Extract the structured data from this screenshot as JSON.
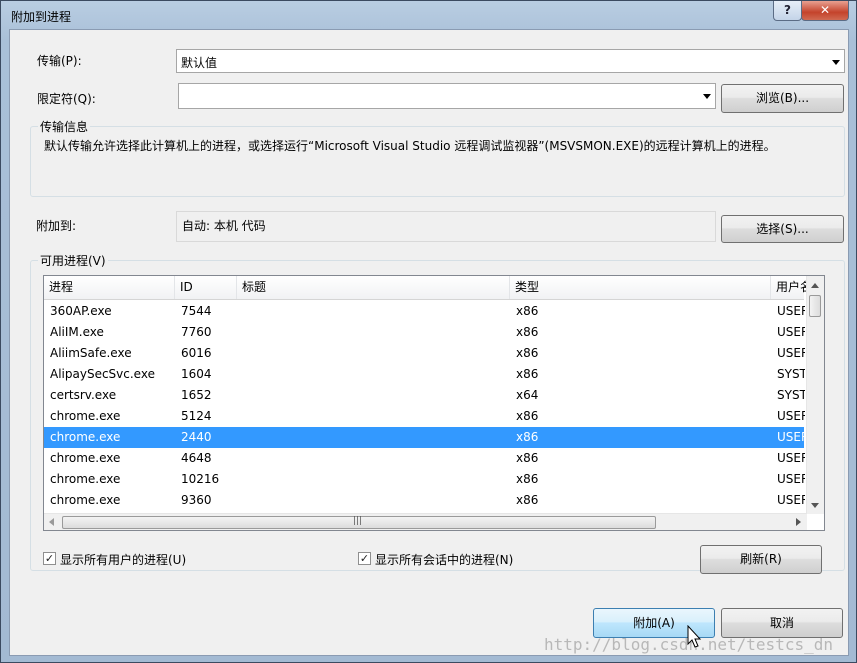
{
  "window": {
    "title": "附加到进程",
    "help_glyph": "?",
    "close_glyph": "✕"
  },
  "transport": {
    "label": "传输(P):",
    "value": "默认值"
  },
  "qualifier": {
    "label": "限定符(Q):",
    "value": "",
    "browse_label": "浏览(B)..."
  },
  "transport_info": {
    "title": "传输信息",
    "text": "默认传输允许选择此计算机上的进程，或选择运行“Microsoft Visual Studio 远程调试监视器”(MSVSMON.EXE)的远程计算机上的进程。"
  },
  "attach_to": {
    "label": "附加到:",
    "value": "自动: 本机 代码",
    "select_label": "选择(S)..."
  },
  "processes": {
    "title": "可用进程(V)",
    "columns": [
      "进程",
      "ID",
      "标题",
      "类型",
      "用户名"
    ],
    "rows": [
      {
        "name": "360AP.exe",
        "id": "7544",
        "title": "",
        "type": "x86",
        "user": "USER"
      },
      {
        "name": "AliIM.exe",
        "id": "7760",
        "title": "",
        "type": "x86",
        "user": "USER"
      },
      {
        "name": "AliimSafe.exe",
        "id": "6016",
        "title": "",
        "type": "x86",
        "user": "USER"
      },
      {
        "name": "AlipaySecSvc.exe",
        "id": "1604",
        "title": "",
        "type": "x86",
        "user": "SYST"
      },
      {
        "name": "certsrv.exe",
        "id": "1652",
        "title": "",
        "type": "x64",
        "user": "SYST"
      },
      {
        "name": "chrome.exe",
        "id": "5124",
        "title": "",
        "type": "x86",
        "user": "USER"
      },
      {
        "name": "chrome.exe",
        "id": "2440",
        "title": "",
        "type": "x86",
        "user": "USER",
        "selected": true
      },
      {
        "name": "chrome.exe",
        "id": "4648",
        "title": "",
        "type": "x86",
        "user": "USER"
      },
      {
        "name": "chrome.exe",
        "id": "10216",
        "title": "",
        "type": "x86",
        "user": "USER"
      },
      {
        "name": "chrome.exe",
        "id": "9360",
        "title": "",
        "type": "x86",
        "user": "USER"
      }
    ],
    "show_all_users": {
      "label": "显示所有用户的进程(U)",
      "checked": true
    },
    "show_all_sessions": {
      "label": "显示所有会话中的进程(N)",
      "checked": true
    },
    "refresh_label": "刷新(R)",
    "hscroll_grip": "|||"
  },
  "footer": {
    "attach_label": "附加(A)",
    "cancel_label": "取消"
  },
  "watermark": "http://blog.csdn.net/testcs_dn",
  "colors": {
    "selection": "#3399ff",
    "primary_button": "#bee6fd"
  }
}
